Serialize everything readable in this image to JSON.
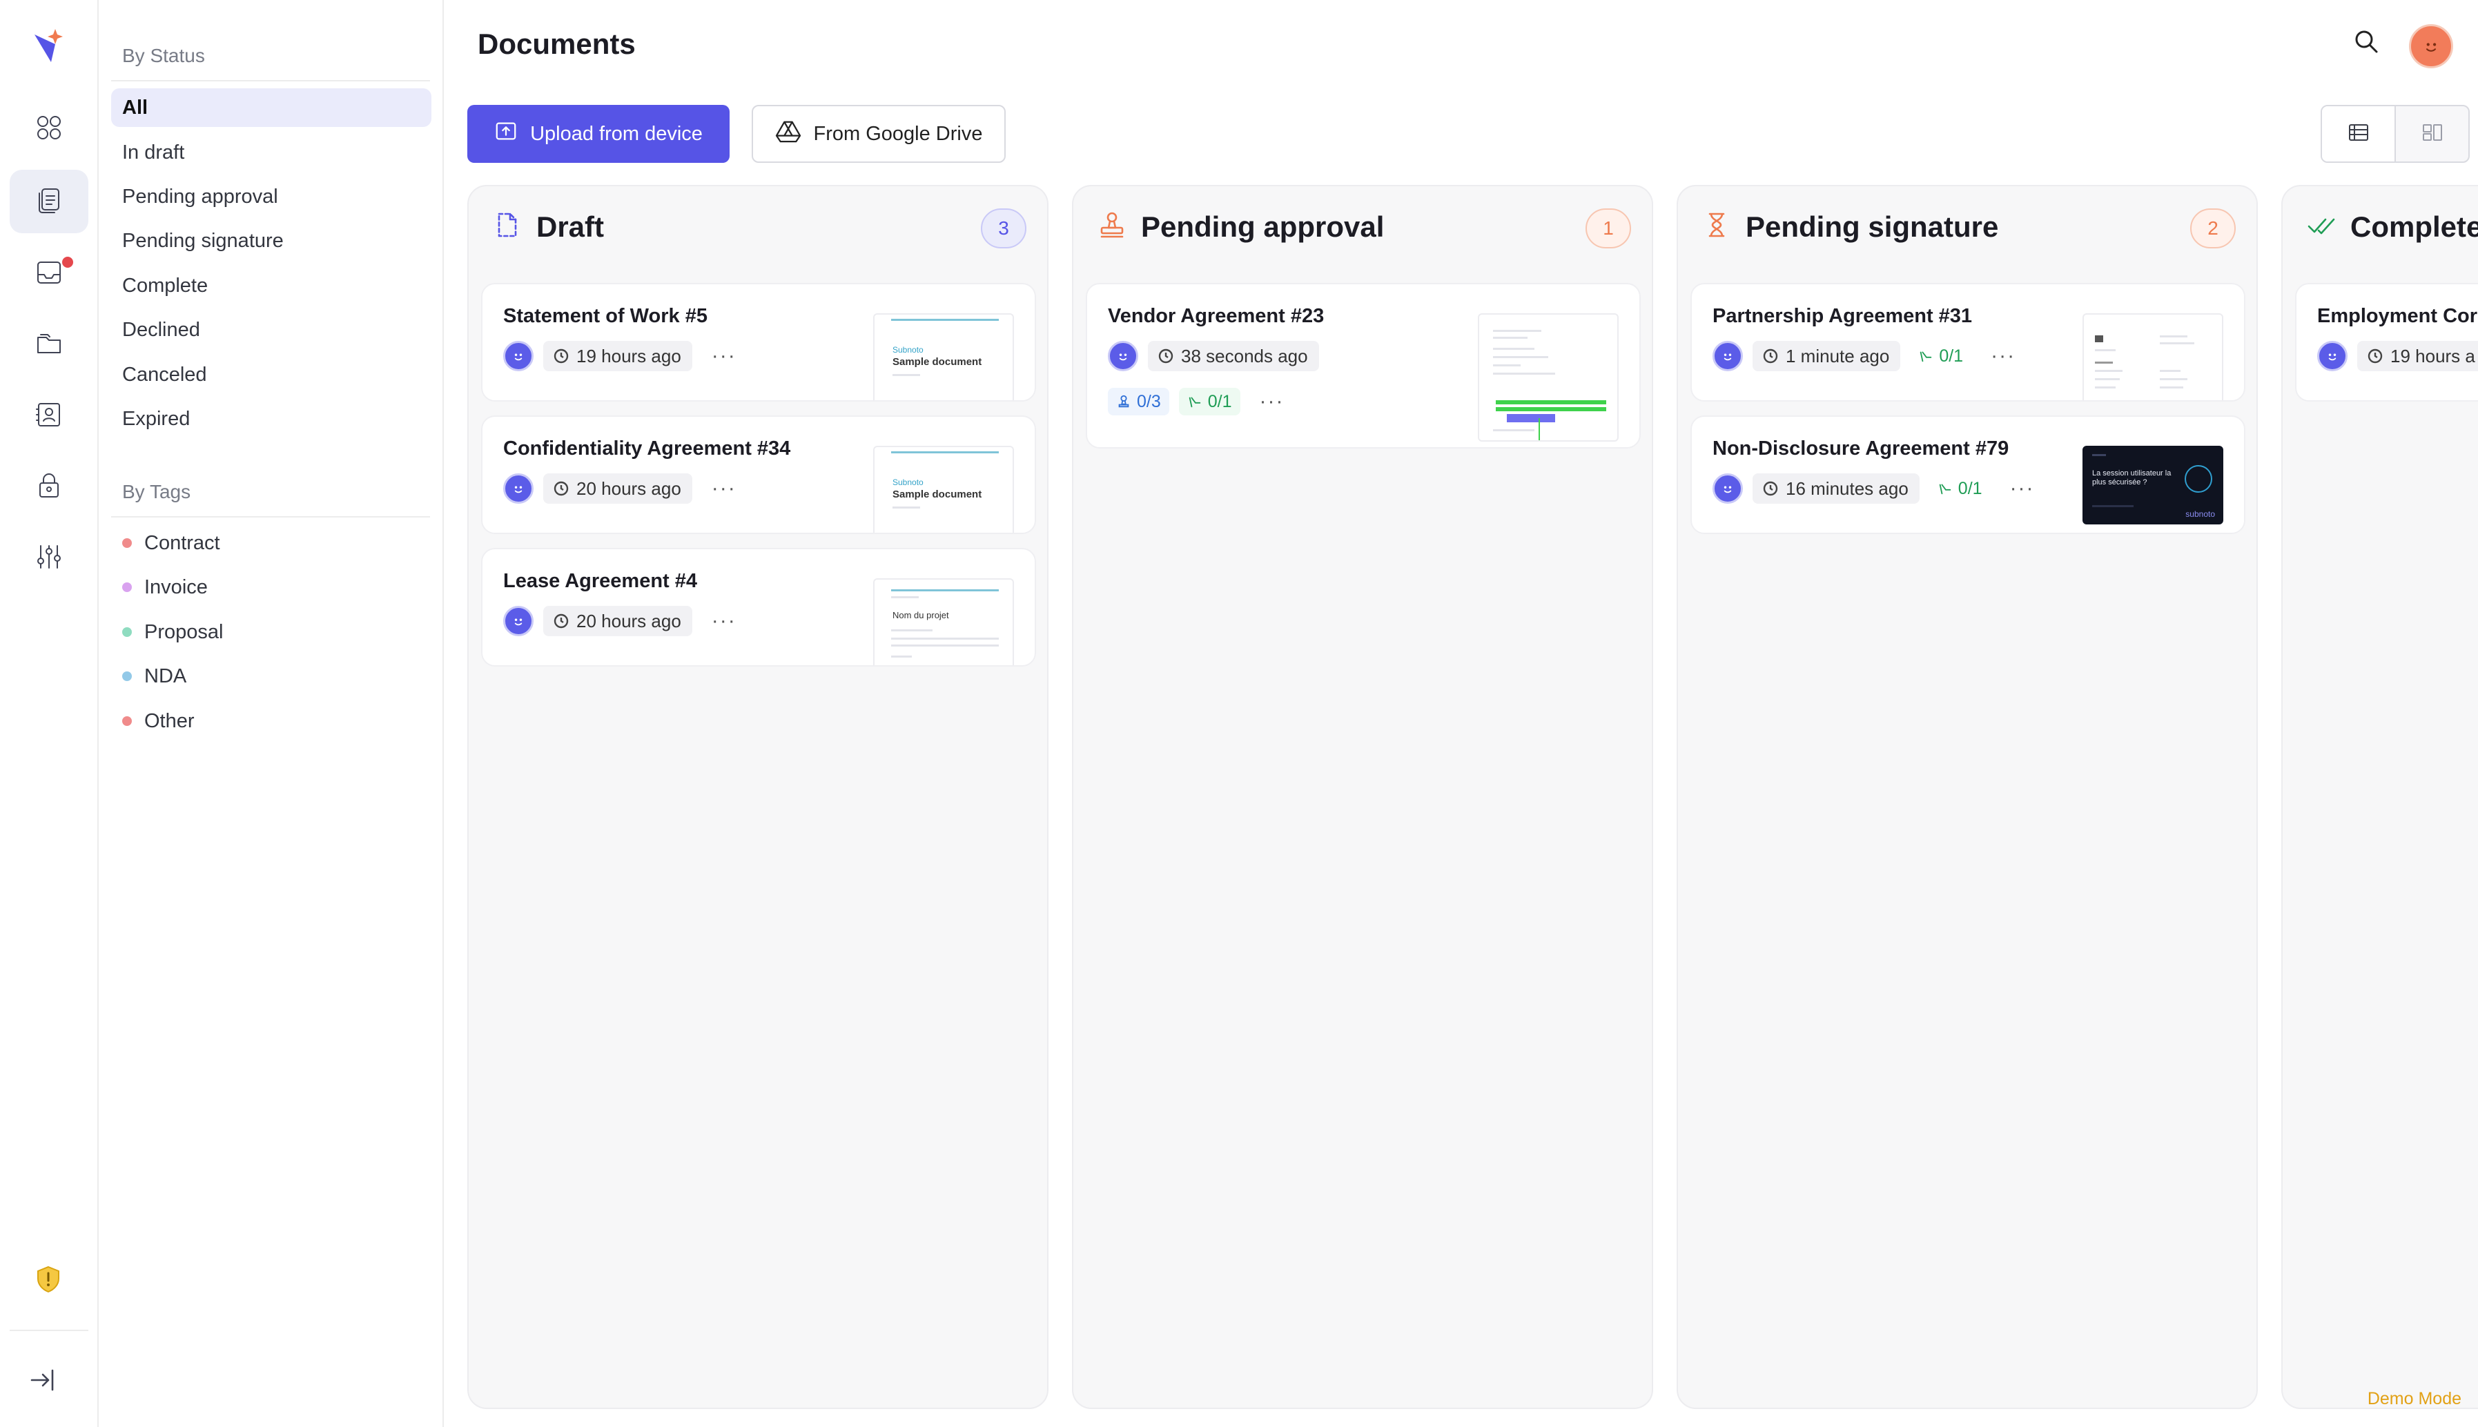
{
  "page": {
    "title": "Documents",
    "upload_label": "Upload from device",
    "gdrive_label": "From Google Drive",
    "demo_label": "Demo Mode"
  },
  "rail": {
    "items": [
      {
        "icon": "grid-icon"
      },
      {
        "icon": "documents-icon",
        "active": true
      },
      {
        "icon": "inbox-icon",
        "badge": true
      },
      {
        "icon": "folders-icon"
      },
      {
        "icon": "contact-card-icon"
      },
      {
        "icon": "lock-icon"
      },
      {
        "icon": "sliders-icon"
      }
    ]
  },
  "filters": {
    "status_title": "By Status",
    "status": [
      {
        "label": "All",
        "active": true
      },
      {
        "label": "In draft"
      },
      {
        "label": "Pending approval"
      },
      {
        "label": "Pending signature"
      },
      {
        "label": "Complete"
      },
      {
        "label": "Declined"
      },
      {
        "label": "Canceled"
      },
      {
        "label": "Expired"
      }
    ],
    "tags_title": "By Tags",
    "tags": [
      {
        "label": "Contract",
        "color": "#f08b8b"
      },
      {
        "label": "Invoice",
        "color": "#d9a2ef"
      },
      {
        "label": "Proposal",
        "color": "#8fdcc0"
      },
      {
        "label": "NDA",
        "color": "#93c9e8"
      },
      {
        "label": "Other",
        "color": "#f08b8b"
      }
    ]
  },
  "columns": [
    {
      "title": "Draft",
      "count": "3",
      "accent": "#5654e6",
      "cards": [
        {
          "title": "Statement of Work #5",
          "time": "19 hours ago",
          "thumb_brand": "Subnoto",
          "thumb_doc": "Sample document"
        },
        {
          "title": "Confidentiality Agreement #34",
          "time": "20 hours ago",
          "thumb_brand": "Subnoto",
          "thumb_doc": "Sample document"
        },
        {
          "title": "Lease Agreement #4",
          "time": "20 hours ago",
          "thumb_brand": "",
          "thumb_doc": "Nom du projet"
        }
      ]
    },
    {
      "title": "Pending approval",
      "count": "1",
      "accent": "#ee7a4c",
      "cards": [
        {
          "title": "Vendor Agreement #23",
          "time": "38 seconds ago",
          "approvals": "0/3",
          "signatures": "0/1"
        }
      ]
    },
    {
      "title": "Pending signature",
      "count": "2",
      "accent": "#ee7a4c",
      "cards": [
        {
          "title": "Partnership Agreement #31",
          "time": "1 minute ago",
          "signatures": "0/1"
        },
        {
          "title": "Non-Disclosure Agreement #79",
          "time": "16 minutes ago",
          "signatures": "0/1",
          "thumb_text": "La session utilisateur la plus sécurisée ?",
          "thumb_brand": "subnoto"
        }
      ]
    },
    {
      "title": "Complete",
      "accent": "#1f9d55",
      "cards": [
        {
          "title": "Employment Cor",
          "time": "19 hours a"
        }
      ]
    }
  ]
}
